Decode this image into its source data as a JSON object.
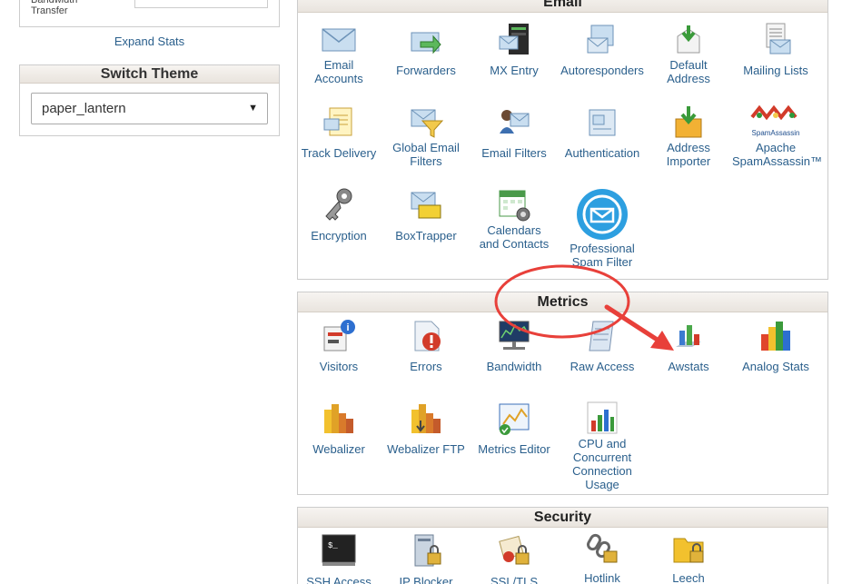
{
  "left": {
    "bandwidth_label": "Bandwidth\nTransfer",
    "expand_stats": "Expand Stats",
    "switch_theme": {
      "title": "Switch Theme",
      "selected": "paper_lantern"
    }
  },
  "email": {
    "title": "Email",
    "items": [
      {
        "label": "Email\nAccounts",
        "icon": "email-accounts-icon"
      },
      {
        "label": "Forwarders",
        "icon": "forwarders-icon"
      },
      {
        "label": "MX Entry",
        "icon": "mx-entry-icon"
      },
      {
        "label": "Autoresponders",
        "icon": "autoresponders-icon"
      },
      {
        "label": "Default\nAddress",
        "icon": "default-address-icon"
      },
      {
        "label": "Mailing Lists",
        "icon": "mailing-lists-icon"
      },
      {
        "label": "Track Delivery",
        "icon": "track-delivery-icon"
      },
      {
        "label": "Global Email\nFilters",
        "icon": "global-email-filters-icon"
      },
      {
        "label": "Email Filters",
        "icon": "email-filters-icon"
      },
      {
        "label": "Authentication",
        "icon": "authentication-icon"
      },
      {
        "label": "Address\nImporter",
        "icon": "address-importer-icon"
      },
      {
        "label": "Apache\nSpamAssassin™",
        "icon": "spamassassin-icon",
        "icon_text": "SpamAssassin"
      },
      {
        "label": "Encryption",
        "icon": "encryption-icon"
      },
      {
        "label": "BoxTrapper",
        "icon": "boxtrapper-icon"
      },
      {
        "label": "Calendars\nand Contacts",
        "icon": "calendars-contacts-icon"
      },
      {
        "label": "Professional\nSpam Filter",
        "icon": "professional-spam-filter-icon"
      }
    ]
  },
  "metrics": {
    "title": "Metrics",
    "items": [
      {
        "label": "Visitors",
        "icon": "visitors-icon"
      },
      {
        "label": "Errors",
        "icon": "errors-icon"
      },
      {
        "label": "Bandwidth",
        "icon": "bandwidth-icon"
      },
      {
        "label": "Raw Access",
        "icon": "raw-access-icon"
      },
      {
        "label": "Awstats",
        "icon": "awstats-icon"
      },
      {
        "label": "Analog Stats",
        "icon": "analog-stats-icon"
      },
      {
        "label": "Webalizer",
        "icon": "webalizer-icon"
      },
      {
        "label": "Webalizer FTP",
        "icon": "webalizer-ftp-icon"
      },
      {
        "label": "Metrics Editor",
        "icon": "metrics-editor-icon"
      },
      {
        "label": "CPU and\nConcurrent\nConnection\nUsage",
        "icon": "cpu-usage-icon"
      }
    ]
  },
  "security": {
    "title": "Security",
    "items": [
      {
        "label": "SSH Access",
        "icon": "ssh-access-icon"
      },
      {
        "label": "IP Blocker",
        "icon": "ip-blocker-icon"
      },
      {
        "label": "SSL/TLS",
        "icon": "ssl-tls-icon"
      },
      {
        "label": "Hotlink",
        "icon": "hotlink-icon"
      },
      {
        "label": "Leech",
        "icon": "leech-icon"
      }
    ]
  },
  "colors": {
    "link": "#2a5f8c",
    "annotation": "#e8403a"
  }
}
